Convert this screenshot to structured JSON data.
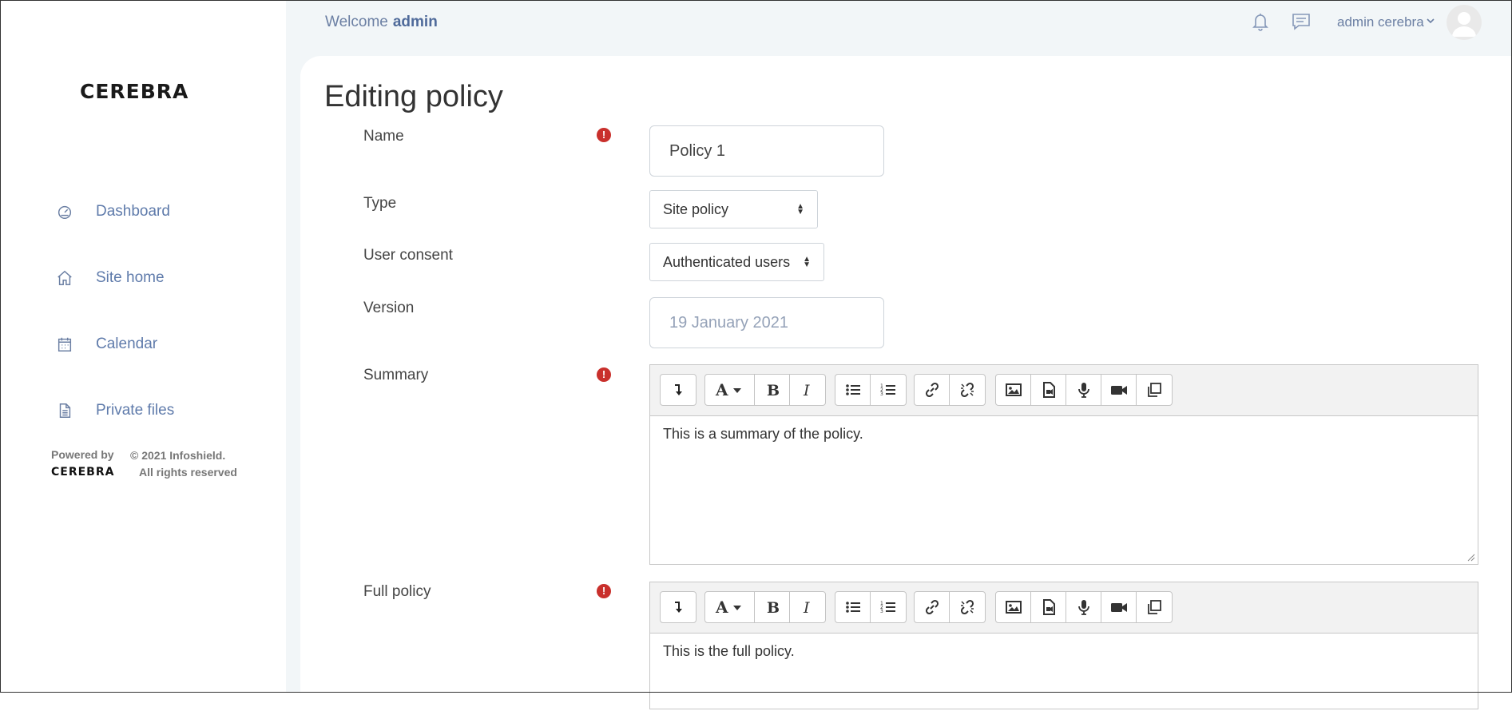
{
  "header": {
    "welcome_prefix": "Welcome",
    "welcome_user": "admin",
    "user_menu_label": "admin cerebra"
  },
  "sidebar": {
    "logo": "CEREBRA",
    "items": [
      {
        "label": "Dashboard",
        "icon": "dashboard-icon"
      },
      {
        "label": "Site home",
        "icon": "home-icon"
      },
      {
        "label": "Calendar",
        "icon": "calendar-icon"
      },
      {
        "label": "Private files",
        "icon": "file-icon"
      }
    ],
    "footer": {
      "powered_by": "Powered by",
      "brand": "CEREBRA",
      "copyright": "© 2021 Infoshield.",
      "rights": "All rights reserved"
    }
  },
  "page": {
    "title": "Editing policy"
  },
  "form": {
    "name_label": "Name",
    "name_value": "Policy 1",
    "type_label": "Type",
    "type_value": "Site policy",
    "consent_label": "User consent",
    "consent_value": "Authenticated users",
    "version_label": "Version",
    "version_value": "19 January 2021",
    "summary_label": "Summary",
    "summary_text": "This is a summary of the policy.",
    "full_label": "Full policy",
    "full_text": "This is the full policy.",
    "required_icon": "!"
  },
  "colors": {
    "accent": "#5f7bab",
    "required": "#c9302c",
    "main_bg": "#f2f6f8"
  }
}
